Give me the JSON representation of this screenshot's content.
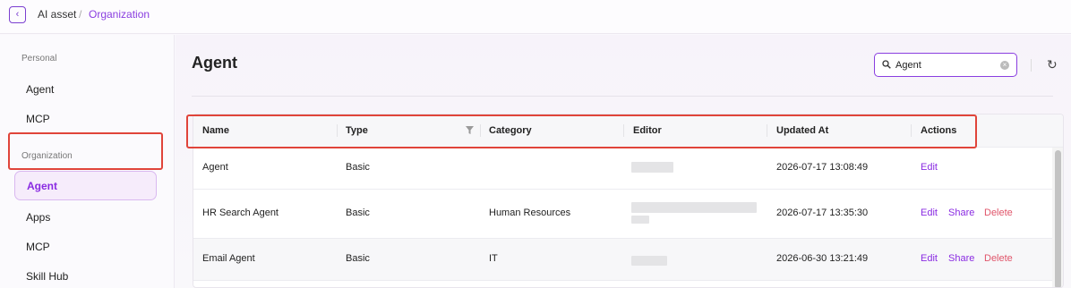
{
  "breadcrumb": {
    "parent": "AI asset",
    "separator": "/",
    "current": "Organization"
  },
  "sidebar": {
    "personal_label": "Personal",
    "personal_items": [
      "Agent",
      "MCP"
    ],
    "org_label": "Organization",
    "org_items": [
      "Agent",
      "Apps",
      "MCP",
      "Skill Hub"
    ],
    "active_item": "Agent"
  },
  "page": {
    "title": "Agent"
  },
  "search": {
    "value": "Agent",
    "placeholder": ""
  },
  "table": {
    "columns": [
      "Name",
      "Type",
      "Category",
      "Editor",
      "Updated At",
      "Actions"
    ],
    "rows": [
      {
        "name": "Agent",
        "type": "Basic",
        "category": "",
        "updated": "2026-07-17 13:08:49",
        "actions": [
          "Edit"
        ]
      },
      {
        "name": "HR Search Agent",
        "type": "Basic",
        "category": "Human Resources",
        "updated": "2026-07-17 13:35:30",
        "actions": [
          "Edit",
          "Share",
          "Delete"
        ]
      },
      {
        "name": "Email Agent",
        "type": "Basic",
        "category": "IT",
        "updated": "2026-06-30 13:21:49",
        "actions": [
          "Edit",
          "Share",
          "Delete"
        ]
      }
    ]
  },
  "colors": {
    "accent": "#8a2be2",
    "delete": "#e0556a",
    "highlight": "#e0443a"
  },
  "icons": [
    "chevron-left-icon",
    "search-icon",
    "clear-icon",
    "refresh-icon",
    "filter-icon"
  ]
}
